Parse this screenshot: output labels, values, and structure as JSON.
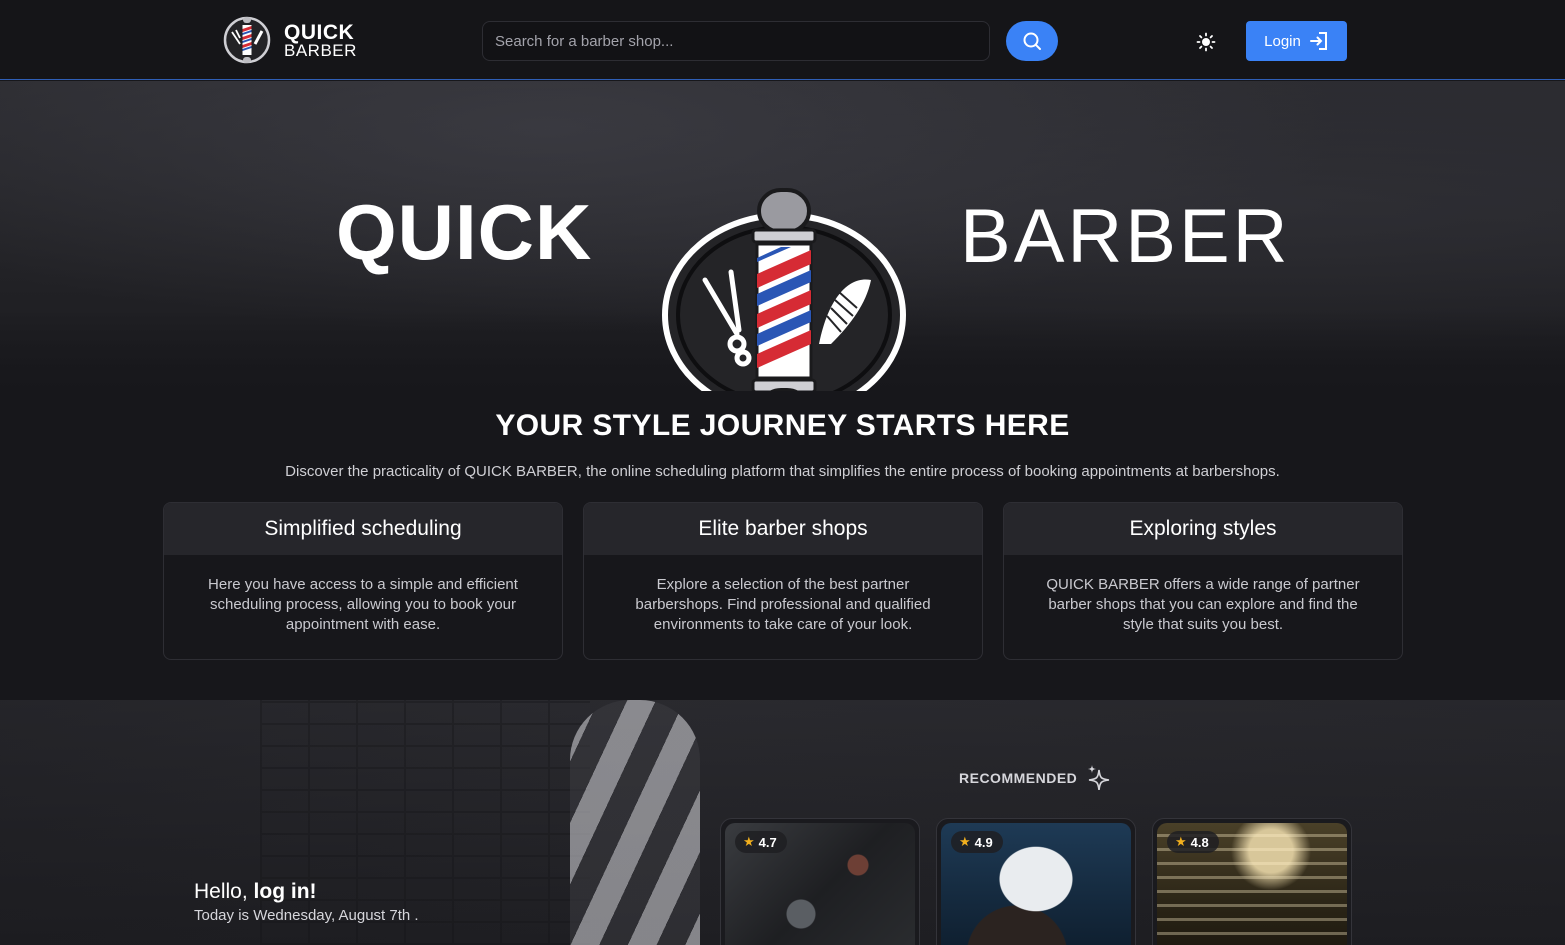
{
  "header": {
    "brand_top": "QUICK",
    "brand_bottom": "BARBER",
    "search_placeholder": "Search for a barber shop...",
    "login_label": "Login",
    "accent_color": "#3a82f6"
  },
  "hero": {
    "word_left": "QUICK",
    "word_right": "BARBER"
  },
  "intro": {
    "tagline": "YOUR STYLE JOURNEY STARTS HERE",
    "description": "Discover the practicality of QUICK BARBER, the online scheduling platform that simplifies the entire process of booking appointments at barbershops."
  },
  "features": [
    {
      "title": "Simplified scheduling",
      "text": "Here you have access to a simple and efficient scheduling process, allowing you to book your appointment with ease."
    },
    {
      "title": "Elite barber shops",
      "text": "Explore a selection of the best partner barbershops. Find professional and qualified environments to take care of your look."
    },
    {
      "title": "Exploring styles",
      "text": "QUICK BARBER offers a wide range of partner barber shops that you can explore and find the style that suits you best."
    }
  ],
  "greeting": {
    "hello": "Hello, ",
    "action": "log in!",
    "today": "Today is Wednesday, August 7th ."
  },
  "recommended": {
    "label": "RECOMMENDED",
    "shops": [
      {
        "rating": "4.7"
      },
      {
        "rating": "4.9"
      },
      {
        "rating": "4.8"
      }
    ]
  },
  "icons": {
    "search": "search-icon",
    "theme": "sun-icon",
    "login": "login-icon",
    "recommended": "sparkles-icon",
    "rating": "star-icon"
  }
}
